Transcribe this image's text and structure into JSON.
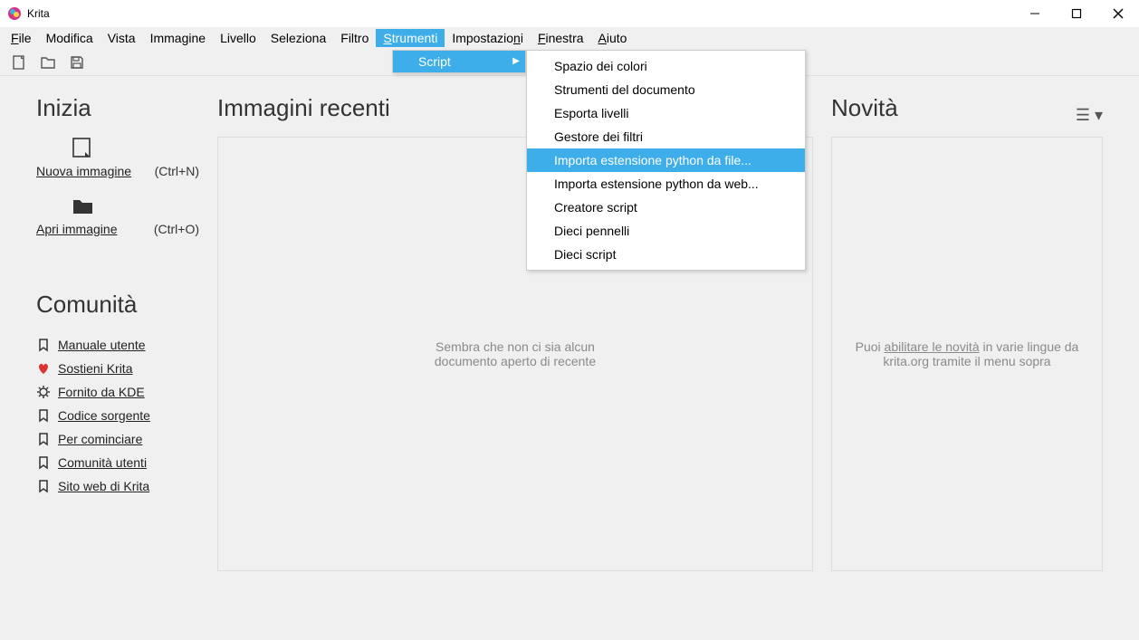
{
  "window": {
    "title": "Krita"
  },
  "menubar": {
    "file": "File",
    "edit": "Modifica",
    "view": "Vista",
    "image": "Immagine",
    "layer": "Livello",
    "select": "Seleziona",
    "filter": "Filtro",
    "tools": "Strumenti",
    "settings": "Impostazioni",
    "window": "Finestra",
    "help": "Aiuto"
  },
  "submenu": {
    "script": "Script"
  },
  "submenu2": {
    "items": [
      "Spazio dei colori",
      "Strumenti del documento",
      "Esporta livelli",
      "Gestore dei filtri",
      "Importa estensione python da file...",
      "Importa estensione python da web...",
      "Creatore script",
      "Dieci pennelli",
      "Dieci script"
    ]
  },
  "start": {
    "heading": "Inizia",
    "new_image": "Nuova immagine",
    "new_shortcut": "(Ctrl+N)",
    "open_image": "Apri immagine",
    "open_shortcut": "(Ctrl+O)"
  },
  "community": {
    "heading": "Comunità",
    "items": [
      "Manuale utente",
      "Sostieni Krita",
      "Fornito da KDE",
      "Codice sorgente",
      "Per cominciare",
      "Comunità utenti",
      "Sito web di Krita"
    ]
  },
  "recent": {
    "heading": "Immagini recenti",
    "empty1": "Sembra che non ci sia alcun",
    "empty2": "documento aperto di recente"
  },
  "news": {
    "heading": "Novità",
    "text1": "Puoi ",
    "link": "abilitare le novità",
    "text2": " in varie lingue da krita.org tramite il menu sopra"
  }
}
